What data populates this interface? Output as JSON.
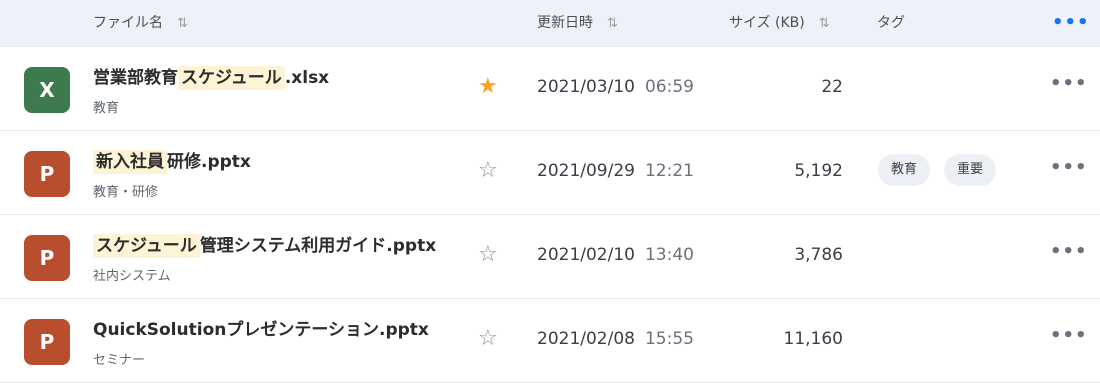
{
  "header": {
    "filename": "ファイル名",
    "updated": "更新日時",
    "size": "サイズ (KB)",
    "tags": "タグ",
    "sort_icon": "⇅",
    "more_icon": "•••"
  },
  "icons": {
    "excel_letter": "X",
    "ppt_letter": "P",
    "star_filled": "★",
    "star_empty": "☆",
    "more": "•••"
  },
  "colors": {
    "excel": "#3d7a4e",
    "powerpoint": "#b84e2e",
    "star_active": "#f5a623",
    "highlight": "#fff3d6",
    "header_bg": "#eef1f7"
  },
  "files": [
    {
      "type": "excel",
      "name_highlight_pre": "",
      "name_plain_pre": "営業部教育",
      "name_highlight": "スケジュール",
      "name_plain": ".xlsx",
      "category": "教育",
      "starred": true,
      "date": "2021/03/10",
      "time": "06:59",
      "size": "22",
      "tags": []
    },
    {
      "type": "powerpoint",
      "name_plain_pre": "",
      "name_highlight": "新入社員",
      "name_plain": "研修.pptx",
      "category": "教育・研修",
      "starred": false,
      "date": "2021/09/29",
      "time": "12:21",
      "size": "5,192",
      "tags": [
        "教育",
        "重要"
      ]
    },
    {
      "type": "powerpoint",
      "name_plain_pre": "",
      "name_highlight": "スケジュール",
      "name_plain": "管理システム利用ガイド.pptx",
      "category": "社内システム",
      "starred": false,
      "date": "2021/02/10",
      "time": "13:40",
      "size": "3,786",
      "tags": []
    },
    {
      "type": "powerpoint",
      "name_plain_pre": "QuickSolutionプレゼンテーション.pptx",
      "name_highlight": "",
      "name_plain": "",
      "category": "セミナー",
      "starred": false,
      "date": "2021/02/08",
      "time": "15:55",
      "size": "11,160",
      "tags": []
    }
  ]
}
